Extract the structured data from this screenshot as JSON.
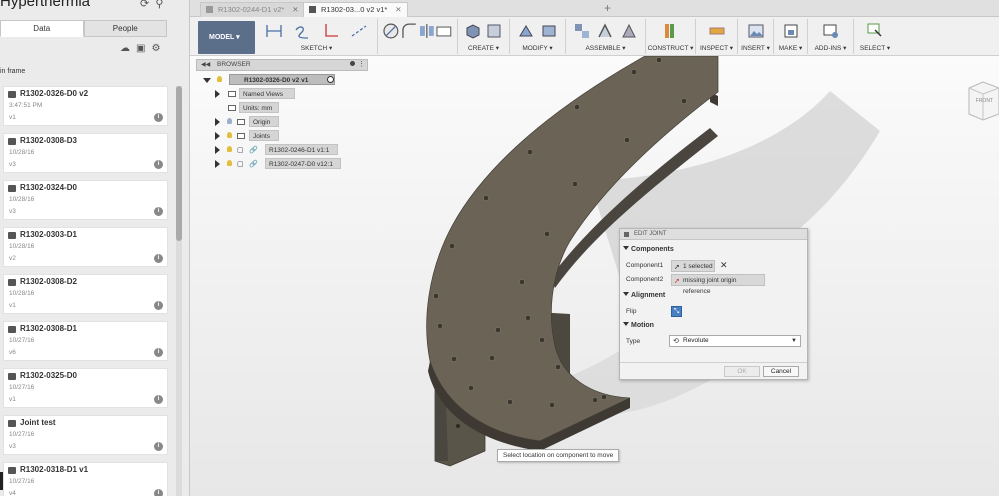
{
  "app": {
    "title": "Hyperthermia"
  },
  "left_panel": {
    "tabs": [
      {
        "label": "Data",
        "active": true
      },
      {
        "label": "People",
        "active": false
      }
    ],
    "in_frame_label": "in frame",
    "files": [
      {
        "name": "R1302-0326-D0 v2",
        "date": "3:47:51 PM",
        "version": "v1"
      },
      {
        "name": "R1302-0308-D3",
        "date": "10/28/16",
        "version": "v3"
      },
      {
        "name": "R1302-0324-D0",
        "date": "10/28/16",
        "version": "v3"
      },
      {
        "name": "R1302-0303-D1",
        "date": "10/28/16",
        "version": "v2"
      },
      {
        "name": "R1302-0308-D2",
        "date": "10/28/16",
        "version": "v1"
      },
      {
        "name": "R1302-0308-D1",
        "date": "10/27/16",
        "version": "v6"
      },
      {
        "name": "R1302-0325-D0",
        "date": "10/27/16",
        "version": "v1"
      },
      {
        "name": "Joint test",
        "date": "10/27/16",
        "version": "v3"
      },
      {
        "name": "R1302-0318-D1 v1",
        "date": "10/27/16",
        "version": "v4"
      }
    ]
  },
  "doc_tabs": [
    {
      "label": "R1302-0244-D1 v2*",
      "active": false
    },
    {
      "label": "R1302-03...0 v2 v1*",
      "active": true
    }
  ],
  "toolbar": {
    "workspace": "MODEL ▾",
    "groups": [
      {
        "label": "SKETCH ▾"
      },
      {
        "label": "CREATE ▾"
      },
      {
        "label": "MODIFY ▾"
      },
      {
        "label": "ASSEMBLE ▾"
      },
      {
        "label": "CONSTRUCT ▾"
      },
      {
        "label": "INSPECT ▾"
      },
      {
        "label": "INSERT ▾"
      },
      {
        "label": "MAKE ▾"
      },
      {
        "label": "ADD-INS ▾"
      },
      {
        "label": "SELECT ▾"
      }
    ]
  },
  "browser": {
    "title": "BROWSER",
    "root": "R1302-0326-D0 v2 v1",
    "nodes": [
      {
        "label": "Named Views"
      },
      {
        "label": "Units: mm"
      },
      {
        "label": "Origin"
      },
      {
        "label": "Joints"
      },
      {
        "label": "R1302-0246-D1 v1:1"
      },
      {
        "label": "R1302-0247-D0 v12:1"
      }
    ]
  },
  "edit_joint": {
    "title": "EDIT JOINT",
    "sections": {
      "components": "Components",
      "alignment": "Alignment",
      "motion": "Motion"
    },
    "component1_label": "Component1",
    "component1_value": "1 selected",
    "component2_label": "Component2",
    "component2_value": "missing joint origin reference",
    "flip_label": "Flip",
    "type_label": "Type",
    "type_value": "Revolute",
    "ok_label": "OK",
    "cancel_label": "Cancel"
  },
  "viewcube_label": "FRONT",
  "tooltip": "Select location on component to move",
  "colors": {
    "model_button": "#5b6e8a",
    "part_face": "#6b6456",
    "flip_button": "#4a7fc4"
  }
}
